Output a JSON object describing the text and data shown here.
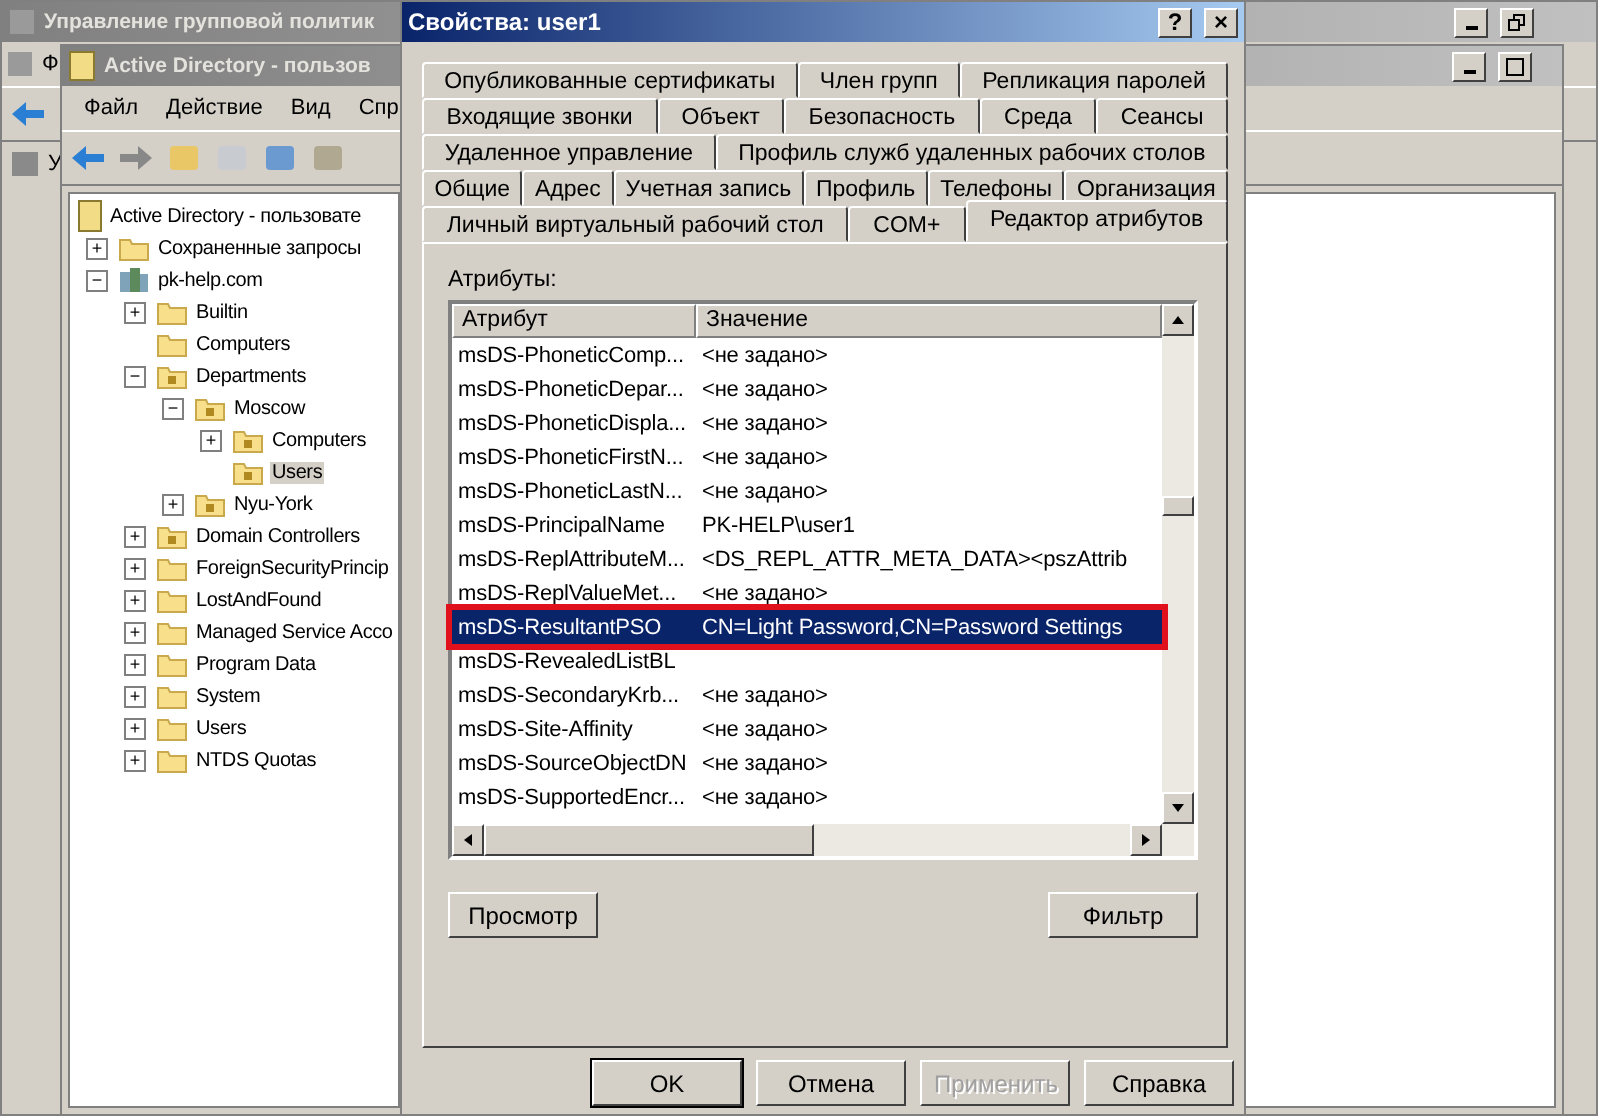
{
  "back_window": {
    "title": "Управление групповой политик",
    "menu_item": "Ф",
    "tree_item": "У"
  },
  "ad_window": {
    "title": "Active Directory - пользов",
    "menu": [
      "Файл",
      "Действие",
      "Вид",
      "Спр"
    ],
    "tree": [
      {
        "label": "Active Directory - пользовате",
        "kind": "root",
        "selected": false,
        "children": [
          {
            "label": "Сохраненные запросы",
            "kind": "folder",
            "toggle": "+",
            "selected": false
          },
          {
            "label": "pk-help.com",
            "kind": "domain",
            "toggle": "−",
            "selected": false,
            "children": [
              {
                "label": "Builtin",
                "kind": "folder",
                "toggle": "+",
                "selected": false
              },
              {
                "label": "Computers",
                "kind": "folder",
                "selected": false
              },
              {
                "label": "Departments",
                "kind": "ou",
                "toggle": "−",
                "selected": false,
                "children": [
                  {
                    "label": "Moscow",
                    "kind": "ou",
                    "toggle": "−",
                    "selected": false,
                    "children": [
                      {
                        "label": "Computers",
                        "kind": "ou",
                        "toggle": "+",
                        "selected": false
                      },
                      {
                        "label": "Users",
                        "kind": "ou",
                        "selected": true
                      }
                    ]
                  },
                  {
                    "label": "Nyu-York",
                    "kind": "ou",
                    "toggle": "+",
                    "selected": false
                  }
                ]
              },
              {
                "label": "Domain Controllers",
                "kind": "ou",
                "toggle": "+",
                "selected": false
              },
              {
                "label": "ForeignSecurityPrincip",
                "kind": "folder",
                "toggle": "+",
                "selected": false
              },
              {
                "label": "LostAndFound",
                "kind": "folder",
                "toggle": "+",
                "selected": false
              },
              {
                "label": "Managed Service Acco",
                "kind": "folder",
                "toggle": "+",
                "selected": false
              },
              {
                "label": "Program Data",
                "kind": "folder",
                "toggle": "+",
                "selected": false
              },
              {
                "label": "System",
                "kind": "folder",
                "toggle": "+",
                "selected": false
              },
              {
                "label": "Users",
                "kind": "folder",
                "toggle": "+",
                "selected": false
              },
              {
                "label": "NTDS Quotas",
                "kind": "folder",
                "toggle": "+",
                "selected": false
              }
            ]
          }
        ]
      }
    ]
  },
  "dialog": {
    "title": "Свойства: user1",
    "help_button": "?",
    "close_button": "×",
    "tab_rows": [
      [
        {
          "label": "Опубликованные сертификаты",
          "selected": false
        },
        {
          "label": "Член групп",
          "selected": false
        },
        {
          "label": "Репликация паролей",
          "selected": false
        }
      ],
      [
        {
          "label": "Входящие звонки",
          "selected": false
        },
        {
          "label": "Объект",
          "selected": false
        },
        {
          "label": "Безопасность",
          "selected": false
        },
        {
          "label": "Среда",
          "selected": false
        },
        {
          "label": "Сеансы",
          "selected": false
        }
      ],
      [
        {
          "label": "Удаленное управление",
          "selected": false
        },
        {
          "label": "Профиль служб удаленных рабочих столов",
          "selected": false
        }
      ],
      [
        {
          "label": "Общие",
          "selected": false
        },
        {
          "label": "Адрес",
          "selected": false
        },
        {
          "label": "Учетная запись",
          "selected": false
        },
        {
          "label": "Профиль",
          "selected": false
        },
        {
          "label": "Телефоны",
          "selected": false
        },
        {
          "label": "Организация",
          "selected": false
        }
      ],
      [
        {
          "label": "Личный виртуальный рабочий стол",
          "selected": false
        },
        {
          "label": "COM+",
          "selected": false
        },
        {
          "label": "Редактор атрибутов",
          "selected": true
        }
      ]
    ],
    "list_label": "Атрибуты:",
    "columns": [
      "Атрибут",
      "Значение"
    ],
    "rows": [
      {
        "name": "msDS-PhoneticComp...",
        "value": "<не задано>",
        "selected": false,
        "outlined": false
      },
      {
        "name": "msDS-PhoneticDepar...",
        "value": "<не задано>",
        "selected": false,
        "outlined": false
      },
      {
        "name": "msDS-PhoneticDispla...",
        "value": "<не задано>",
        "selected": false,
        "outlined": false
      },
      {
        "name": "msDS-PhoneticFirstN...",
        "value": "<не задано>",
        "selected": false,
        "outlined": false
      },
      {
        "name": "msDS-PhoneticLastN...",
        "value": "<не задано>",
        "selected": false,
        "outlined": false
      },
      {
        "name": "msDS-PrincipalName",
        "value": "PK-HELP\\user1",
        "selected": false,
        "outlined": false
      },
      {
        "name": "msDS-ReplAttributeM...",
        "value": "<DS_REPL_ATTR_META_DATA><pszAttrib",
        "selected": false,
        "outlined": false
      },
      {
        "name": "msDS-ReplValueMet...",
        "value": "<не задано>",
        "selected": false,
        "outlined": false
      },
      {
        "name": "msDS-ResultantPSO",
        "value": "CN=Light Password,CN=Password Settings",
        "selected": true,
        "outlined": true
      },
      {
        "name": "msDS-RevealedListBL",
        "selected": false,
        "outlined": false
      },
      {
        "name": "msDS-SecondaryKrb...",
        "value": "<не задано>",
        "selected": false,
        "outlined": false
      },
      {
        "name": "msDS-Site-Affinity",
        "value": "<не задано>",
        "selected": false,
        "outlined": false
      },
      {
        "name": "msDS-SourceObjectDN",
        "value": "<не задано>",
        "selected": false,
        "outlined": false
      },
      {
        "name": "msDS-SupportedEncr...",
        "value": "<не задано>",
        "selected": false,
        "outlined": false
      }
    ],
    "panel_buttons": [
      {
        "label": "Просмотр",
        "disabled": false
      },
      {
        "label": "Фильтр",
        "disabled": false
      }
    ],
    "buttons": [
      {
        "label": "OK",
        "disabled": false,
        "default": true
      },
      {
        "label": "Отмена",
        "disabled": false,
        "default": false
      },
      {
        "label": "Применить",
        "disabled": true,
        "default": false
      },
      {
        "label": "Справка",
        "disabled": false,
        "default": false
      }
    ]
  }
}
